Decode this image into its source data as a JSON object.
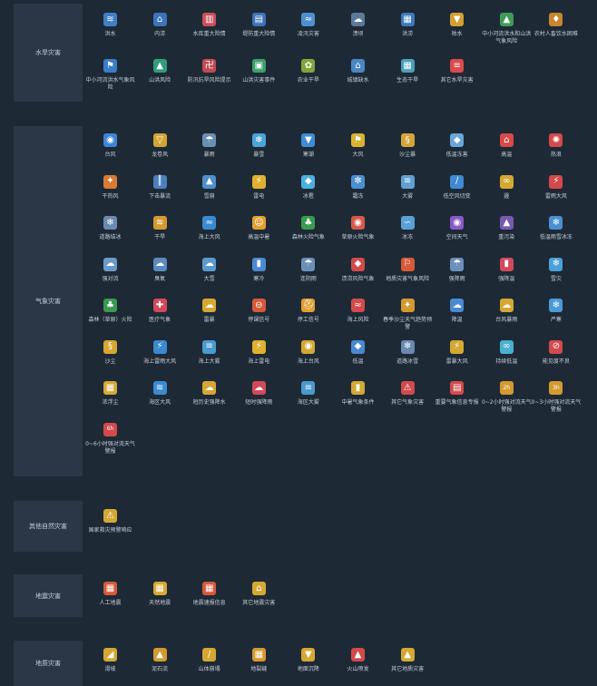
{
  "colors": {
    "background": "#1e2936",
    "panel": "#293747"
  },
  "sections": [
    {
      "category": "水旱灾害",
      "items": [
        {
          "label": "洪水",
          "icon": "flood-icon",
          "color": "#3f80c4",
          "glyph": "≋"
        },
        {
          "label": "内涝",
          "icon": "waterlogging-icon",
          "color": "#3b74b8",
          "glyph": "⌂"
        },
        {
          "label": "水库重大险情",
          "icon": "reservoir-danger-icon",
          "color": "#c8505a",
          "glyph": "▥"
        },
        {
          "label": "堤防重大险情",
          "icon": "dike-danger-icon",
          "color": "#3e72b5",
          "glyph": "▤"
        },
        {
          "label": "凌汛灾害",
          "icon": "ice-flood-icon",
          "color": "#4e8fd0",
          "glyph": "≈"
        },
        {
          "label": "溃坝",
          "icon": "dam-break-icon",
          "color": "#5a7a9a",
          "glyph": "☁"
        },
        {
          "label": "洪涝",
          "icon": "flood-waterlog-icon",
          "color": "#3d79bb",
          "glyph": "▦"
        },
        {
          "label": "枯水",
          "icon": "low-water-icon",
          "color": "#d2a032",
          "glyph": "▼"
        },
        {
          "label": "中小河流洪水和山洪气象风险",
          "icon": "river-flash-flood-icon",
          "color": "#3f9a5a",
          "glyph": "▲"
        },
        {
          "label": "农村人畜饮水困难",
          "icon": "rural-drinking-water-icon",
          "color": "#c6862e",
          "glyph": "♦"
        },
        {
          "label": "中小河流洪水气象风险",
          "icon": "river-flood-risk-icon",
          "color": "#3a7ec6",
          "glyph": "⚑"
        },
        {
          "label": "山洪风险",
          "icon": "mountain-flood-icon",
          "color": "#2f9e7a",
          "glyph": "▲"
        },
        {
          "label": "防汛抗旱风险提示",
          "icon": "flood-drought-warning-icon",
          "color": "#c24a52",
          "glyph": "卍"
        },
        {
          "label": "山洪灾害事件",
          "icon": "mountain-flood-event-icon",
          "color": "#3aa06a",
          "glyph": "▣"
        },
        {
          "label": "农业干旱",
          "icon": "agri-drought-icon",
          "color": "#7fa63a",
          "glyph": "✿"
        },
        {
          "label": "城镇缺水",
          "icon": "urban-water-shortage-icon",
          "color": "#4a86c5",
          "glyph": "⌂"
        },
        {
          "label": "生态干旱",
          "icon": "eco-drought-icon",
          "color": "#4aa0b8",
          "glyph": "▦"
        },
        {
          "label": "其它水旱灾害",
          "icon": "other-flood-drought-icon",
          "color": "#d94a4a",
          "glyph": "≡"
        }
      ]
    },
    {
      "category": "气象灾害",
      "items": [
        {
          "label": "台风",
          "icon": "typhoon-icon",
          "color": "#3b86d6",
          "glyph": "◉"
        },
        {
          "label": "龙卷风",
          "icon": "tornado-icon",
          "color": "#d2a632",
          "glyph": "▽"
        },
        {
          "label": "暴雨",
          "icon": "rainstorm-icon",
          "color": "#6a8fb5",
          "glyph": "☂"
        },
        {
          "label": "暴雪",
          "icon": "blizzard-icon",
          "color": "#49a4d8",
          "glyph": "❄"
        },
        {
          "label": "寒潮",
          "icon": "cold-wave-icon",
          "color": "#3f8ed4",
          "glyph": "▼"
        },
        {
          "label": "大风",
          "icon": "gale-icon",
          "color": "#d9b232",
          "glyph": "⚑"
        },
        {
          "label": "沙尘暴",
          "icon": "sandstorm-icon",
          "color": "#d4a63a",
          "glyph": "§"
        },
        {
          "label": "低温冻害",
          "icon": "low-temp-frost-icon",
          "color": "#6aa6d8",
          "glyph": "◆"
        },
        {
          "label": "高温",
          "icon": "high-temp-icon",
          "color": "#d64a4a",
          "glyph": "⌂"
        },
        {
          "label": "热浪",
          "icon": "heat-wave-icon",
          "color": "#d24a4a",
          "glyph": "✺"
        },
        {
          "label": "干热风",
          "icon": "dry-hot-wind-icon",
          "color": "#d97b32",
          "glyph": "✦"
        },
        {
          "label": "下击暴流",
          "icon": "downburst-icon",
          "color": "#4a7fc0",
          "glyph": "║"
        },
        {
          "label": "雪崩",
          "icon": "avalanche-icon",
          "color": "#4f8fcc",
          "glyph": "▲"
        },
        {
          "label": "雷电",
          "icon": "lightning-icon",
          "color": "#e0b030",
          "glyph": "⚡"
        },
        {
          "label": "冰雹",
          "icon": "hail-icon",
          "color": "#4ab0e0",
          "glyph": "◆"
        },
        {
          "label": "霜冻",
          "icon": "frost-icon",
          "color": "#4a8fd0",
          "glyph": "✼"
        },
        {
          "label": "大雾",
          "icon": "heavy-fog-icon",
          "color": "#5fa0d0",
          "glyph": "≡"
        },
        {
          "label": "低空风切变",
          "icon": "wind-shear-icon",
          "color": "#3f8ad0",
          "glyph": "∕"
        },
        {
          "label": "霾",
          "icon": "haze-icon",
          "color": "#d4a832",
          "glyph": "∞"
        },
        {
          "label": "雷雨大风",
          "icon": "thunderstorm-gale-icon",
          "color": "#d24a4a",
          "glyph": "⚡"
        },
        {
          "label": "道路结冰",
          "icon": "road-icing-icon",
          "color": "#6a8ab0",
          "glyph": "❄"
        },
        {
          "label": "干旱",
          "icon": "drought-icon",
          "color": "#d49a30",
          "glyph": "≋"
        },
        {
          "label": "海上大风",
          "icon": "sea-gale-icon",
          "color": "#3a8ad0",
          "glyph": "≈"
        },
        {
          "label": "高温中暑",
          "icon": "heatstroke-icon",
          "color": "#e0a032",
          "glyph": "☺"
        },
        {
          "label": "森林火险气象",
          "icon": "forest-fire-weather-icon",
          "color": "#3a9a50",
          "glyph": "♣"
        },
        {
          "label": "草原火险气象",
          "icon": "grassland-fire-weather-icon",
          "color": "#d45a4a",
          "glyph": "◉"
        },
        {
          "label": "冰冻",
          "icon": "freezing-icon",
          "color": "#5aa0d8",
          "glyph": "∽"
        },
        {
          "label": "空间天气",
          "icon": "space-weather-icon",
          "color": "#8a5ac8",
          "glyph": "◉"
        },
        {
          "label": "重污染",
          "icon": "heavy-pollution-icon",
          "color": "#7a5ab0",
          "glyph": "▲"
        },
        {
          "label": "低温雨雪冰冻",
          "icon": "low-temp-rain-snow-icon",
          "color": "#4a90d0",
          "glyph": "❄"
        },
        {
          "label": "强对流",
          "icon": "severe-convection-icon",
          "color": "#6a9ac8",
          "glyph": "☁"
        },
        {
          "label": "臭氧",
          "icon": "ozone-icon",
          "color": "#5a8ac0",
          "glyph": "☁"
        },
        {
          "label": "大雪",
          "icon": "heavy-snow-icon",
          "color": "#5a9ad0",
          "glyph": "☁"
        },
        {
          "label": "寒冷",
          "icon": "cold-icon",
          "color": "#4a8ad0",
          "glyph": "▮"
        },
        {
          "label": "连阴雨",
          "icon": "continuous-rain-icon",
          "color": "#6a8fb8",
          "glyph": "☂"
        },
        {
          "label": "渍涝风险气象",
          "icon": "waterlogging-weather-icon",
          "color": "#d24a4a",
          "glyph": "◆"
        },
        {
          "label": "地质灾害气象风险",
          "icon": "geo-hazard-weather-icon",
          "color": "#d45a3a",
          "glyph": "⚐"
        },
        {
          "label": "强降雨",
          "icon": "heavy-rainfall-icon",
          "color": "#6a8fb8",
          "glyph": "☂"
        },
        {
          "label": "强降温",
          "icon": "sharp-cooling-icon",
          "color": "#d24a5a",
          "glyph": "▮"
        },
        {
          "label": "雪灾",
          "icon": "snow-disaster-icon",
          "color": "#4aa0d8",
          "glyph": "❄"
        },
        {
          "label": "森林（草原）火险",
          "icon": "forest-grassland-fire-icon",
          "color": "#3a9a50",
          "glyph": "♣"
        },
        {
          "label": "医疗气象",
          "icon": "medical-weather-icon",
          "color": "#d24a5a",
          "glyph": "✚"
        },
        {
          "label": "雷暴",
          "icon": "thunderstorm-icon",
          "color": "#d4a832",
          "glyph": "☁"
        },
        {
          "label": "停课信号",
          "icon": "class-suspension-icon",
          "color": "#d45a3a",
          "glyph": "⊖"
        },
        {
          "label": "停工信号",
          "icon": "work-suspension-icon",
          "color": "#e0a032",
          "glyph": "⛑"
        },
        {
          "label": "海上风险",
          "icon": "sea-risk-icon",
          "color": "#d24a4a",
          "glyph": "≈"
        },
        {
          "label": "春季沙尘天气趋势预警",
          "icon": "spring-dust-trend-icon",
          "color": "#d49a30",
          "glyph": "✦"
        },
        {
          "label": "降温",
          "icon": "cooling-icon",
          "color": "#4a8ad0",
          "glyph": "☁"
        },
        {
          "label": "台风暴雨",
          "icon": "typhoon-rainstorm-icon",
          "color": "#d4a832",
          "glyph": "☁"
        },
        {
          "label": "严寒",
          "icon": "severe-cold-icon",
          "color": "#4a9ad8",
          "glyph": "❄"
        },
        {
          "label": "沙尘",
          "icon": "dust-icon",
          "color": "#d4a832",
          "glyph": "§"
        },
        {
          "label": "海上雷雨大风",
          "icon": "sea-thunder-gale-icon",
          "color": "#3a8ad0",
          "glyph": "⚡"
        },
        {
          "label": "海上大雾",
          "icon": "sea-fog-icon",
          "color": "#4a9ad0",
          "glyph": "≡"
        },
        {
          "label": "海上雷电",
          "icon": "sea-lightning-icon",
          "color": "#e0b030",
          "glyph": "⚡"
        },
        {
          "label": "海上台风",
          "icon": "sea-typhoon-icon",
          "color": "#d4a832",
          "glyph": "◉"
        },
        {
          "label": "低温",
          "icon": "low-temp-icon",
          "color": "#4a8ad0",
          "glyph": "◆"
        },
        {
          "label": "道路冰雪",
          "icon": "road-ice-snow-icon",
          "color": "#6a8ab0",
          "glyph": "❄"
        },
        {
          "label": "雷暴大风",
          "icon": "thunder-gale-icon",
          "color": "#d4a832",
          "glyph": "⚡"
        },
        {
          "label": "持续低温",
          "icon": "persistent-low-temp-icon",
          "color": "#4ab0d0",
          "glyph": "∞"
        },
        {
          "label": "能见度不良",
          "icon": "poor-visibility-icon",
          "color": "#d24a4a",
          "glyph": "⊘"
        },
        {
          "label": "浓浮尘",
          "icon": "dense-dust-icon",
          "color": "#d4a832",
          "glyph": "▦"
        },
        {
          "label": "海区大风",
          "icon": "sea-area-gale-icon",
          "color": "#3a8ad0",
          "glyph": "≋"
        },
        {
          "label": "短历史强降水",
          "icon": "short-heavy-rain-icon",
          "color": "#d4a832",
          "glyph": "☁"
        },
        {
          "label": "短时强降雨",
          "icon": "short-term-rainstorm-icon",
          "color": "#d24a5a",
          "glyph": "☁"
        },
        {
          "label": "海区大雾",
          "icon": "sea-area-fog-icon",
          "color": "#4a9ad0",
          "glyph": "≡"
        },
        {
          "label": "中暑气象条件",
          "icon": "heatstroke-condition-icon",
          "color": "#d4a832",
          "glyph": "▮"
        },
        {
          "label": "其它气象灾害",
          "icon": "other-weather-icon",
          "color": "#d24a4a",
          "glyph": "⚠"
        },
        {
          "label": "重要气象信息专报",
          "icon": "important-weather-report-icon",
          "color": "#d24a4a",
          "glyph": "▤"
        },
        {
          "label": "0~2小时强对流天气警报",
          "icon": "convection-2h-icon",
          "color": "#d49a30",
          "glyph": "2h"
        },
        {
          "label": "0~3小时强对流天气警报",
          "icon": "convection-3h-icon",
          "color": "#d49a30",
          "glyph": "3h"
        },
        {
          "label": "0~6小时强对流天气警报",
          "icon": "convection-6h-icon",
          "color": "#d24a4a",
          "glyph": "6h"
        }
      ]
    },
    {
      "category": "其他自然灾害",
      "items": [
        {
          "label": "国家救灾预警响应",
          "icon": "national-relief-alarm-icon",
          "color": "#d4a832",
          "glyph": "⚠"
        }
      ]
    },
    {
      "category": "地震灾害",
      "items": [
        {
          "label": "人工地震",
          "icon": "artificial-earthquake-icon",
          "color": "#d45a3a",
          "glyph": "▦"
        },
        {
          "label": "天然地震",
          "icon": "natural-earthquake-icon",
          "color": "#d4a832",
          "glyph": "▦"
        },
        {
          "label": "地震速报信息",
          "icon": "earthquake-report-icon",
          "color": "#d45a3a",
          "glyph": "▦"
        },
        {
          "label": "其它地震灾害",
          "icon": "other-earthquake-icon",
          "color": "#d4a832",
          "glyph": "⌂"
        }
      ]
    },
    {
      "category": "地质灾害",
      "items": [
        {
          "label": "滑坡",
          "icon": "landslide-icon",
          "color": "#d4a832",
          "glyph": "◢"
        },
        {
          "label": "泥石流",
          "icon": "debris-flow-icon",
          "color": "#d49a30",
          "glyph": "▲"
        },
        {
          "label": "山体崩塌",
          "icon": "rockfall-icon",
          "color": "#d4a832",
          "glyph": "∕"
        },
        {
          "label": "地裂缝",
          "icon": "ground-fissure-icon",
          "color": "#d49a30",
          "glyph": "▦"
        },
        {
          "label": "地面沉降",
          "icon": "land-subsidence-icon",
          "color": "#d4a832",
          "glyph": "▼"
        },
        {
          "label": "火山喷发",
          "icon": "volcanic-eruption-icon",
          "color": "#d24a4a",
          "glyph": "▲"
        },
        {
          "label": "其它地质灾害",
          "icon": "other-geo-hazard-icon",
          "color": "#d4a832",
          "glyph": "▲"
        }
      ]
    }
  ]
}
